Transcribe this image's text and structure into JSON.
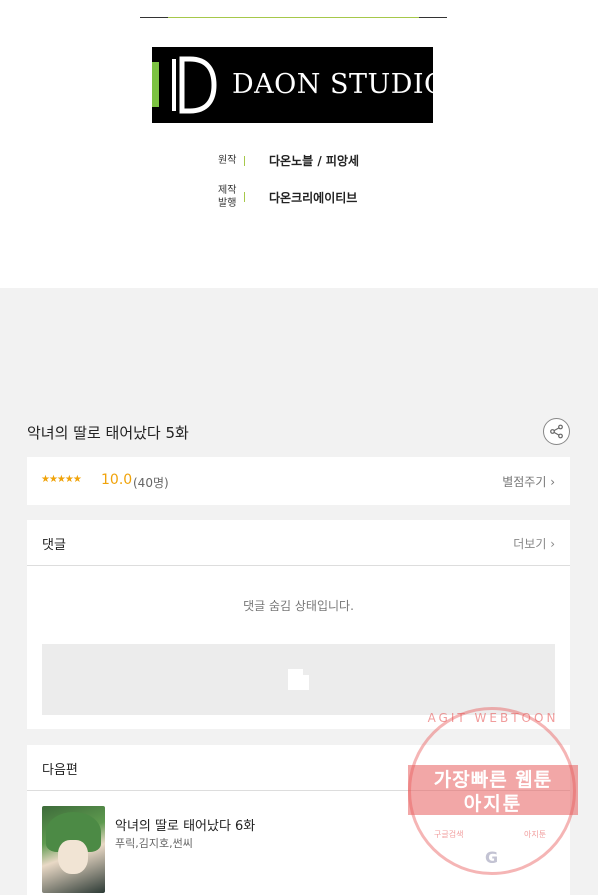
{
  "credits": {
    "logo_text": "DAON STUDIO",
    "original_label": "원작",
    "original_value": "다온노블 / 피앙세",
    "production_label_1": "제작",
    "production_label_2": "발행",
    "production_value": "다온크리에이티브"
  },
  "episode": {
    "title": "악녀의 딸로 태어났다 5화"
  },
  "rating": {
    "stars": "★★★★★",
    "score": "10.0",
    "count": "(40명)",
    "rate_button": "별점주기 ›"
  },
  "comments": {
    "title": "댓글",
    "more": "더보기 ›",
    "hidden_message": "댓글 숨김 상태입니다."
  },
  "next_episode": {
    "title": "다음편",
    "episode_title": "악녀의 딸로 태어났다 6화",
    "authors": "푸릭,김지호,썬씨"
  },
  "watermark": {
    "arc_text": "AGIT WEBTOON",
    "line1": "가장빠른 웹툰",
    "line2": "아지툰",
    "bottom_left": "구글검색",
    "bottom_right": "아지툰",
    "google": "G"
  },
  "colors": {
    "accent_green": "#a6c84a",
    "star_orange": "#f0a30a"
  }
}
